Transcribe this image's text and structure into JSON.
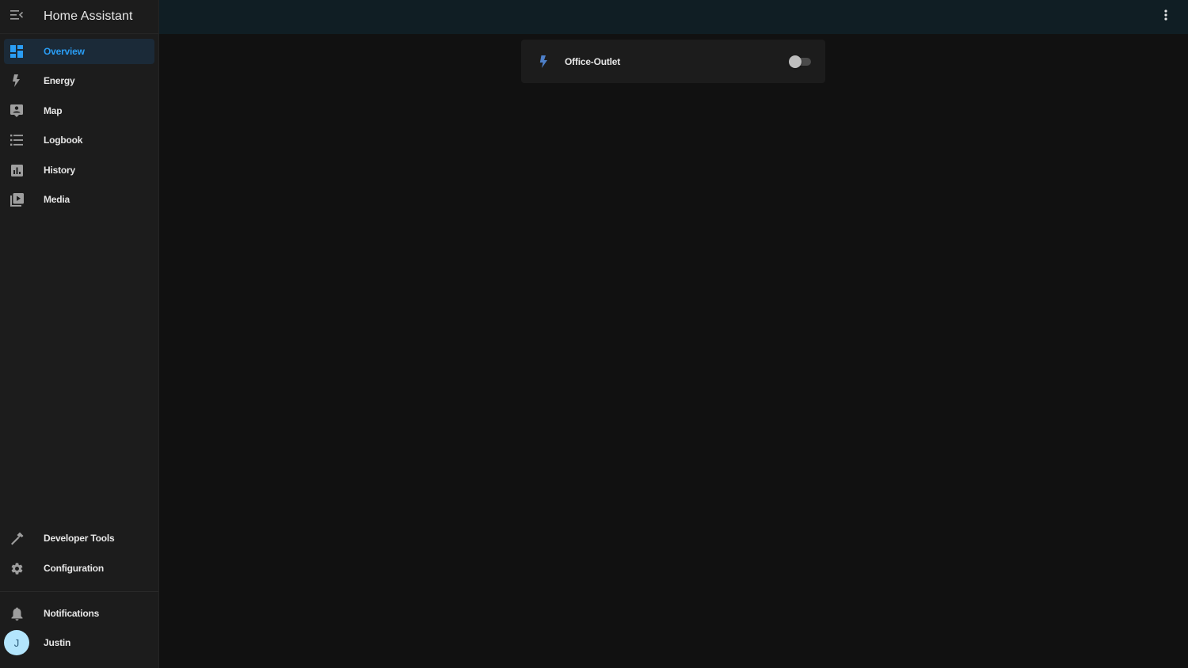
{
  "app": {
    "title": "Home Assistant"
  },
  "sidebar": {
    "items": [
      {
        "label": "Overview",
        "icon": "dashboard-icon",
        "active": true
      },
      {
        "label": "Energy",
        "icon": "lightning-icon"
      },
      {
        "label": "Map",
        "icon": "map-account-icon"
      },
      {
        "label": "Logbook",
        "icon": "list-icon"
      },
      {
        "label": "History",
        "icon": "chart-bar-icon"
      },
      {
        "label": "Media",
        "icon": "play-box-multiple-icon"
      }
    ],
    "bottom_items": [
      {
        "label": "Developer Tools",
        "icon": "hammer-icon"
      },
      {
        "label": "Configuration",
        "icon": "gear-icon"
      }
    ],
    "notifications": {
      "label": "Notifications",
      "icon": "bell-icon"
    },
    "user": {
      "name": "Justin",
      "initial": "J"
    }
  },
  "main": {
    "cards": [
      {
        "entity_name": "Office-Outlet",
        "icon": "flash-icon",
        "state": "off"
      }
    ]
  },
  "colors": {
    "accent": "#2a9df4",
    "sidebar_bg": "#1c1c1c",
    "topbar_bg": "#101e24",
    "main_bg": "#111111",
    "active_item_bg": "#1b2a38",
    "icon_blue": "#4d7fc8"
  }
}
